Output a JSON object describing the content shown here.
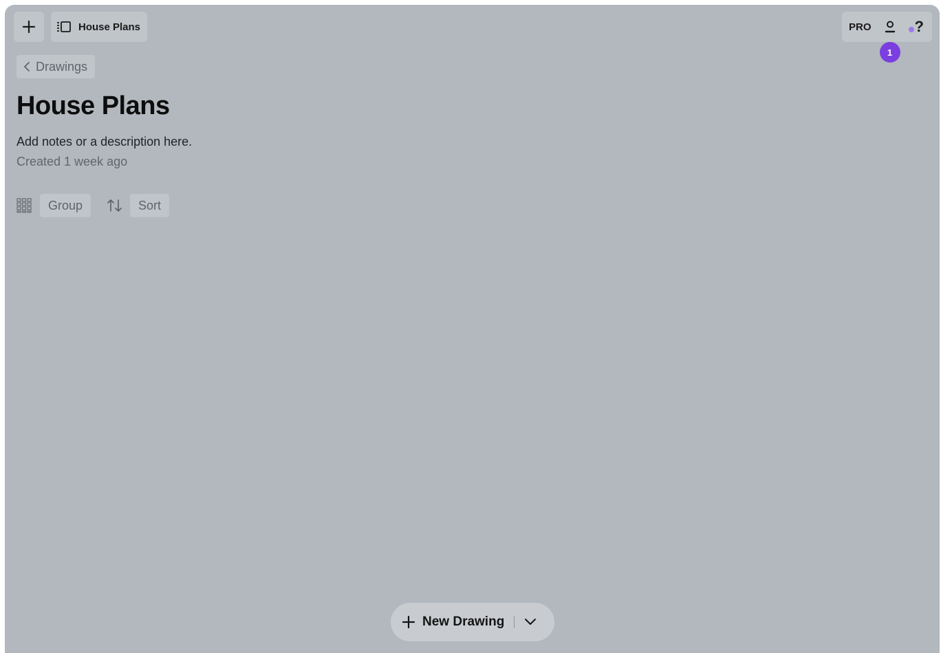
{
  "toolbar": {
    "add_icon": "plus-icon",
    "doc_icon": "sidebar-panel-icon",
    "doc_title": "House Plans",
    "pro_label": "PRO",
    "user_icon": "user-icon",
    "notification_count": "1",
    "help_label": "?",
    "colors": {
      "badge": "#7b3fe0",
      "help_dot": "#9c7be8"
    }
  },
  "nav": {
    "back_icon": "chevron-left-icon",
    "back_label": "Drawings"
  },
  "page": {
    "title": "House Plans",
    "description": "Add notes or a description here.",
    "created": "Created 1 week ago"
  },
  "controls": {
    "group_icon": "grid-icon",
    "group_label": "Group",
    "sort_icon": "sort-arrows-icon",
    "sort_label": "Sort"
  },
  "footer": {
    "new_icon": "plus-icon",
    "new_label": "New Drawing",
    "dropdown_icon": "chevron-down-icon"
  }
}
